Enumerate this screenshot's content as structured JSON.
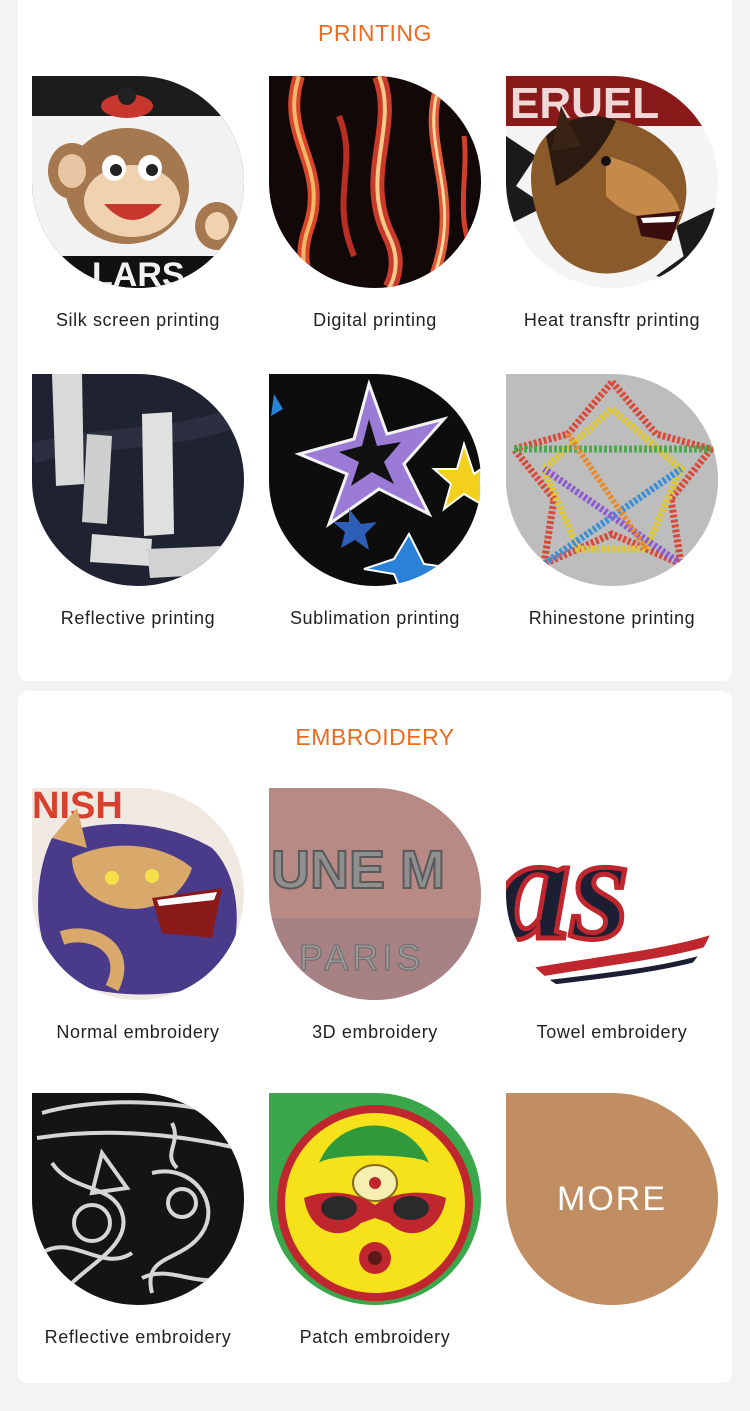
{
  "sections": [
    {
      "title": "PRINTING",
      "items": [
        {
          "label": "Silk screen printing"
        },
        {
          "label": "Digital printing"
        },
        {
          "label": "Heat transftr printing"
        },
        {
          "label": "Reflective printing"
        },
        {
          "label": "Sublimation printing"
        },
        {
          "label": "Rhinestone printing"
        }
      ]
    },
    {
      "title": "EMBROIDERY",
      "items": [
        {
          "label": "Normal embroidery"
        },
        {
          "label": "3D embroidery"
        },
        {
          "label": "Towel embroidery"
        },
        {
          "label": "Reflective embroidery"
        },
        {
          "label": "Patch embroidery"
        },
        {
          "label": "MORE"
        }
      ]
    }
  ],
  "image_text": {
    "heat_transfer": "ERUEL",
    "embroidery_3d_top": "UNE M",
    "embroidery_3d_bottom": "PARIS",
    "towel": "as"
  },
  "colors": {
    "accent": "#ee6a1e",
    "more_tile": "#c18e64"
  }
}
